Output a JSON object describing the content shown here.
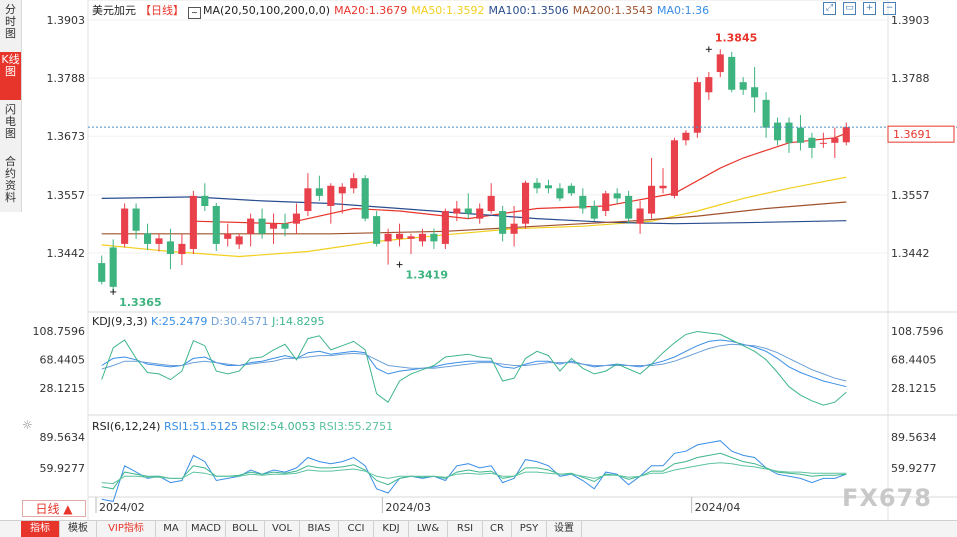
{
  "symbol": "美元加元",
  "period_label": "【日线】",
  "ma_indicator": "MA(20,50,100,200,0,0)",
  "ma_values": [
    {
      "text": "MA20:1.3679",
      "color": "#e8352b"
    },
    {
      "text": "MA50:1.3592",
      "color": "#f2cf1d"
    },
    {
      "text": "MA100:1.3506",
      "color": "#2a4d8f"
    },
    {
      "text": "MA200:1.3543",
      "color": "#a0522d"
    },
    {
      "text": "MA0:1.36",
      "color": "#3a8ee6"
    }
  ],
  "kdj": {
    "label": "KDJ(9,3,3)",
    "k": "K:25.2479",
    "d": "D:30.4571",
    "j": "J:14.8295"
  },
  "rsi": {
    "label": "RSI(6,12,24)",
    "r1": "RSI1:51.5125",
    "r2": "RSI2:54.0053",
    "r3": "RSI3:55.2751"
  },
  "side_tabs": [
    "分时图",
    "K线图",
    "闪电图",
    "合约资料"
  ],
  "period_button": "日线 ▲",
  "bottom_tabs": [
    "指标",
    "模板",
    "VIP指标",
    "MA",
    "MACD",
    "BOLL",
    "VOL",
    "BIAS",
    "CCI",
    "KDJ",
    "LW&",
    "RSI",
    "CR",
    "PSY",
    "设置"
  ],
  "watermark": "FX678",
  "current_price_label": "1.3691",
  "marks": {
    "high": "1.3845",
    "low1": "1.3365",
    "low2": "1.3419"
  },
  "colors": {
    "up": "#e8414b",
    "down": "#3db37f",
    "k": "#3a8ee6",
    "d": "#6a9fd8",
    "j": "#3fb68a"
  },
  "chart_data": {
    "type": "candlestick",
    "symbol": "USD/CAD",
    "price_ticks": [
      "1.3903",
      "1.3788",
      "1.3673",
      "1.3557",
      "1.3442"
    ],
    "kdj_ticks": [
      "108.7596",
      "68.4405",
      "28.1215"
    ],
    "rsi_ticks": [
      "89.5634",
      "59.9277"
    ],
    "x_labels": [
      "2024/02",
      "2024/03",
      "2024/04"
    ],
    "current_price": 1.3691,
    "annotations": [
      {
        "text": "1.3845",
        "value": 1.3845,
        "bar": 53
      },
      {
        "text": "1.3365",
        "value": 1.3365,
        "bar": 1
      },
      {
        "text": "1.3419",
        "value": 1.3419,
        "bar": 26
      }
    ],
    "candles": [
      {
        "o": 1.3422,
        "h": 1.3437,
        "l": 1.338,
        "c": 1.3385
      },
      {
        "o": 1.3453,
        "h": 1.3469,
        "l": 1.3365,
        "c": 1.3375
      },
      {
        "o": 1.346,
        "h": 1.354,
        "l": 1.3453,
        "c": 1.353
      },
      {
        "o": 1.353,
        "h": 1.354,
        "l": 1.347,
        "c": 1.3486
      },
      {
        "o": 1.3481,
        "h": 1.35,
        "l": 1.3448,
        "c": 1.346
      },
      {
        "o": 1.346,
        "h": 1.348,
        "l": 1.3445,
        "c": 1.3471
      },
      {
        "o": 1.3465,
        "h": 1.349,
        "l": 1.341,
        "c": 1.344
      },
      {
        "o": 1.344,
        "h": 1.348,
        "l": 1.3418,
        "c": 1.346
      },
      {
        "o": 1.345,
        "h": 1.3565,
        "l": 1.344,
        "c": 1.3555
      },
      {
        "o": 1.3555,
        "h": 1.358,
        "l": 1.3525,
        "c": 1.3535
      },
      {
        "o": 1.3535,
        "h": 1.3541,
        "l": 1.3446,
        "c": 1.346
      },
      {
        "o": 1.347,
        "h": 1.35,
        "l": 1.3455,
        "c": 1.348
      },
      {
        "o": 1.3459,
        "h": 1.348,
        "l": 1.345,
        "c": 1.3475
      },
      {
        "o": 1.348,
        "h": 1.352,
        "l": 1.3455,
        "c": 1.351
      },
      {
        "o": 1.351,
        "h": 1.353,
        "l": 1.347,
        "c": 1.348
      },
      {
        "o": 1.349,
        "h": 1.352,
        "l": 1.346,
        "c": 1.35
      },
      {
        "o": 1.35,
        "h": 1.352,
        "l": 1.3475,
        "c": 1.349
      },
      {
        "o": 1.35,
        "h": 1.354,
        "l": 1.348,
        "c": 1.352
      },
      {
        "o": 1.3525,
        "h": 1.36,
        "l": 1.3515,
        "c": 1.357
      },
      {
        "o": 1.357,
        "h": 1.3595,
        "l": 1.3545,
        "c": 1.3555
      },
      {
        "o": 1.3535,
        "h": 1.358,
        "l": 1.35,
        "c": 1.3575
      },
      {
        "o": 1.356,
        "h": 1.358,
        "l": 1.352,
        "c": 1.3573
      },
      {
        "o": 1.357,
        "h": 1.36,
        "l": 1.356,
        "c": 1.359
      },
      {
        "o": 1.359,
        "h": 1.3596,
        "l": 1.3505,
        "c": 1.351
      },
      {
        "o": 1.3515,
        "h": 1.3525,
        "l": 1.3455,
        "c": 1.346
      },
      {
        "o": 1.3465,
        "h": 1.349,
        "l": 1.3419,
        "c": 1.348
      },
      {
        "o": 1.347,
        "h": 1.35,
        "l": 1.3455,
        "c": 1.348
      },
      {
        "o": 1.347,
        "h": 1.348,
        "l": 1.344,
        "c": 1.3475
      },
      {
        "o": 1.3465,
        "h": 1.349,
        "l": 1.3455,
        "c": 1.348
      },
      {
        "o": 1.348,
        "h": 1.349,
        "l": 1.345,
        "c": 1.3465
      },
      {
        "o": 1.346,
        "h": 1.353,
        "l": 1.345,
        "c": 1.3525
      },
      {
        "o": 1.352,
        "h": 1.3545,
        "l": 1.3505,
        "c": 1.353
      },
      {
        "o": 1.353,
        "h": 1.356,
        "l": 1.351,
        "c": 1.352
      },
      {
        "o": 1.351,
        "h": 1.354,
        "l": 1.35,
        "c": 1.353
      },
      {
        "o": 1.3525,
        "h": 1.358,
        "l": 1.352,
        "c": 1.3555
      },
      {
        "o": 1.3525,
        "h": 1.3535,
        "l": 1.3465,
        "c": 1.348
      },
      {
        "o": 1.348,
        "h": 1.3535,
        "l": 1.3455,
        "c": 1.35
      },
      {
        "o": 1.35,
        "h": 1.3585,
        "l": 1.349,
        "c": 1.3581
      },
      {
        "o": 1.3581,
        "h": 1.359,
        "l": 1.356,
        "c": 1.357
      },
      {
        "o": 1.3576,
        "h": 1.3587,
        "l": 1.356,
        "c": 1.357
      },
      {
        "o": 1.357,
        "h": 1.358,
        "l": 1.3545,
        "c": 1.355
      },
      {
        "o": 1.3575,
        "h": 1.358,
        "l": 1.3555,
        "c": 1.356
      },
      {
        "o": 1.3555,
        "h": 1.357,
        "l": 1.352,
        "c": 1.353
      },
      {
        "o": 1.3535,
        "h": 1.3546,
        "l": 1.3505,
        "c": 1.351
      },
      {
        "o": 1.3525,
        "h": 1.3565,
        "l": 1.3515,
        "c": 1.356
      },
      {
        "o": 1.356,
        "h": 1.357,
        "l": 1.354,
        "c": 1.355
      },
      {
        "o": 1.3555,
        "h": 1.3565,
        "l": 1.35,
        "c": 1.351
      },
      {
        "o": 1.35,
        "h": 1.3545,
        "l": 1.348,
        "c": 1.353
      },
      {
        "o": 1.352,
        "h": 1.363,
        "l": 1.351,
        "c": 1.3575
      },
      {
        "o": 1.357,
        "h": 1.361,
        "l": 1.356,
        "c": 1.3575
      },
      {
        "o": 1.3555,
        "h": 1.367,
        "l": 1.355,
        "c": 1.3665
      },
      {
        "o": 1.3665,
        "h": 1.3685,
        "l": 1.3655,
        "c": 1.368
      },
      {
        "o": 1.368,
        "h": 1.379,
        "l": 1.367,
        "c": 1.378
      },
      {
        "o": 1.376,
        "h": 1.38,
        "l": 1.3745,
        "c": 1.379
      },
      {
        "o": 1.38,
        "h": 1.3845,
        "l": 1.379,
        "c": 1.3835
      },
      {
        "o": 1.383,
        "h": 1.384,
        "l": 1.376,
        "c": 1.3765
      },
      {
        "o": 1.378,
        "h": 1.379,
        "l": 1.3755,
        "c": 1.3765
      },
      {
        "o": 1.377,
        "h": 1.381,
        "l": 1.372,
        "c": 1.375
      },
      {
        "o": 1.3745,
        "h": 1.376,
        "l": 1.367,
        "c": 1.369
      },
      {
        "o": 1.37,
        "h": 1.371,
        "l": 1.3655,
        "c": 1.3665
      },
      {
        "o": 1.37,
        "h": 1.371,
        "l": 1.364,
        "c": 1.366
      },
      {
        "o": 1.369,
        "h": 1.3715,
        "l": 1.3645,
        "c": 1.366
      },
      {
        "o": 1.367,
        "h": 1.368,
        "l": 1.363,
        "c": 1.365
      },
      {
        "o": 1.366,
        "h": 1.368,
        "l": 1.365,
        "c": 1.366
      },
      {
        "o": 1.366,
        "h": 1.369,
        "l": 1.363,
        "c": 1.367
      },
      {
        "o": 1.3661,
        "h": 1.37,
        "l": 1.3655,
        "c": 1.3691
      }
    ],
    "series": [
      {
        "name": "MA20",
        "color": "#e8352b",
        "points": [
          [
            8,
            1.3505
          ],
          [
            16,
            1.35
          ],
          [
            22,
            1.353
          ],
          [
            26,
            1.3525
          ],
          [
            32,
            1.351
          ],
          [
            38,
            1.353
          ],
          [
            44,
            1.3535
          ],
          [
            50,
            1.356
          ],
          [
            54,
            1.361
          ],
          [
            56,
            1.363
          ],
          [
            60,
            1.366
          ],
          [
            64,
            1.367
          ],
          [
            65,
            1.3679
          ]
        ]
      },
      {
        "name": "MA50",
        "color": "#f2cf1d",
        "points": [
          [
            0,
            1.3458
          ],
          [
            6,
            1.3445
          ],
          [
            12,
            1.3435
          ],
          [
            18,
            1.3445
          ],
          [
            24,
            1.3465
          ],
          [
            30,
            1.3478
          ],
          [
            36,
            1.349
          ],
          [
            42,
            1.3495
          ],
          [
            48,
            1.3505
          ],
          [
            52,
            1.3525
          ],
          [
            56,
            1.355
          ],
          [
            60,
            1.357
          ],
          [
            65,
            1.3592
          ]
        ]
      },
      {
        "name": "MA100",
        "color": "#2a4d8f",
        "points": [
          [
            0,
            1.355
          ],
          [
            8,
            1.3553
          ],
          [
            14,
            1.3545
          ],
          [
            20,
            1.354
          ],
          [
            26,
            1.353
          ],
          [
            32,
            1.352
          ],
          [
            38,
            1.351
          ],
          [
            44,
            1.3503
          ],
          [
            50,
            1.35
          ],
          [
            56,
            1.3502
          ],
          [
            65,
            1.3506
          ]
        ]
      },
      {
        "name": "MA200",
        "color": "#a0522d",
        "points": [
          [
            0,
            1.348
          ],
          [
            12,
            1.348
          ],
          [
            20,
            1.348
          ],
          [
            30,
            1.3485
          ],
          [
            38,
            1.3495
          ],
          [
            46,
            1.3505
          ],
          [
            52,
            1.3515
          ],
          [
            58,
            1.353
          ],
          [
            65,
            1.3543
          ]
        ]
      }
    ],
    "kdj_series": [
      {
        "name": "K",
        "color": "#3a8ee6",
        "values": [
          60,
          70,
          72,
          68,
          62,
          60,
          58,
          60,
          70,
          72,
          64,
          60,
          60,
          64,
          66,
          70,
          74,
          70,
          78,
          80,
          76,
          78,
          80,
          78,
          56,
          48,
          52,
          54,
          56,
          58,
          62,
          64,
          66,
          66,
          66,
          58,
          56,
          62,
          66,
          66,
          62,
          66,
          62,
          58,
          60,
          62,
          60,
          58,
          62,
          66,
          72,
          80,
          88,
          94,
          96,
          94,
          90,
          86,
          80,
          70,
          58,
          50,
          44,
          38,
          34,
          30
        ]
      },
      {
        "name": "D",
        "color": "#6a9fd8",
        "values": [
          55,
          60,
          66,
          66,
          64,
          62,
          60,
          60,
          64,
          66,
          64,
          62,
          60,
          62,
          64,
          66,
          70,
          70,
          72,
          74,
          74,
          76,
          77,
          76,
          68,
          60,
          58,
          56,
          56,
          56,
          58,
          60,
          62,
          64,
          64,
          62,
          60,
          60,
          62,
          64,
          64,
          64,
          62,
          60,
          60,
          60,
          60,
          60,
          60,
          62,
          66,
          72,
          78,
          84,
          88,
          90,
          89,
          88,
          84,
          78,
          70,
          62,
          54,
          48,
          42,
          38
        ]
      },
      {
        "name": "J",
        "color": "#3fb68a",
        "values": [
          40,
          85,
          96,
          70,
          50,
          48,
          40,
          52,
          95,
          88,
          52,
          48,
          52,
          70,
          72,
          82,
          90,
          68,
          98,
          102,
          82,
          88,
          94,
          82,
          20,
          8,
          38,
          48,
          54,
          60,
          72,
          74,
          76,
          72,
          70,
          38,
          42,
          70,
          80,
          74,
          52,
          70,
          56,
          48,
          52,
          62,
          55,
          48,
          62,
          78,
          92,
          104,
          108,
          106,
          104,
          96,
          88,
          80,
          68,
          50,
          30,
          18,
          10,
          4,
          8,
          22
        ]
      }
    ],
    "rsi_series": [
      {
        "name": "RSI1",
        "color": "#3a8ee6",
        "values": [
          30,
          28,
          62,
          56,
          50,
          52,
          46,
          48,
          72,
          66,
          48,
          50,
          52,
          58,
          54,
          58,
          56,
          60,
          70,
          66,
          64,
          66,
          70,
          62,
          40,
          36,
          50,
          52,
          50,
          52,
          48,
          62,
          64,
          60,
          62,
          46,
          50,
          68,
          66,
          62,
          52,
          54,
          48,
          40,
          56,
          54,
          44,
          52,
          62,
          62,
          74,
          76,
          82,
          84,
          86,
          76,
          72,
          70,
          60,
          54,
          52,
          50,
          46,
          50,
          50,
          54
        ]
      },
      {
        "name": "RSI2",
        "color": "#3fb68a",
        "values": [
          42,
          40,
          56,
          54,
          52,
          52,
          50,
          50,
          62,
          60,
          52,
          52,
          53,
          56,
          54,
          56,
          55,
          57,
          62,
          60,
          60,
          61,
          63,
          58,
          48,
          44,
          50,
          52,
          51,
          52,
          50,
          56,
          58,
          56,
          57,
          50,
          52,
          60,
          60,
          58,
          54,
          55,
          51,
          47,
          54,
          53,
          49,
          52,
          57,
          57,
          64,
          66,
          70,
          72,
          74,
          70,
          66,
          64,
          60,
          56,
          55,
          54,
          52,
          53,
          53,
          54
        ]
      },
      {
        "name": "RSI3",
        "color": "#5cc3a0",
        "values": [
          46,
          45,
          52,
          52,
          51,
          51,
          50,
          50,
          56,
          55,
          52,
          52,
          52,
          54,
          53,
          54,
          54,
          55,
          58,
          57,
          57,
          58,
          59,
          57,
          52,
          50,
          52,
          52,
          52,
          52,
          51,
          54,
          55,
          54,
          55,
          52,
          52,
          56,
          56,
          55,
          54,
          54,
          52,
          50,
          53,
          53,
          51,
          52,
          55,
          55,
          58,
          60,
          62,
          64,
          65,
          64,
          62,
          61,
          59,
          57,
          56,
          56,
          55,
          55,
          55,
          55
        ]
      }
    ]
  }
}
